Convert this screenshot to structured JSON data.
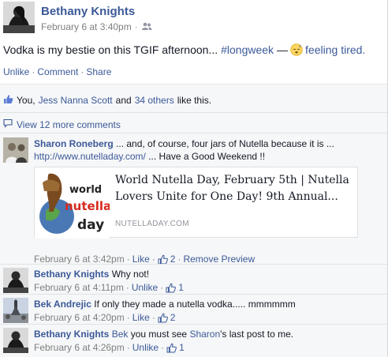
{
  "post": {
    "author": "Bethany Knights",
    "timestamp": "February 6 at 3:40pm",
    "audience_icon": "friends-icon",
    "status_text": "Vodka is my bestie on this TGIF afternoon...",
    "hashtag": "#longweek",
    "dash": "—",
    "feeling_icon": "sleepy-face-emoji",
    "feeling_text": "feeling tired.",
    "actions": {
      "unlike": "Unlike",
      "comment": "Comment",
      "share": "Share",
      "separator": "·"
    }
  },
  "likes": {
    "icon": "like-thumb-icon",
    "you": "You,",
    "friend": "Jess Nanna Scott",
    "and": "and",
    "others": "34 others",
    "suffix": "like this."
  },
  "more_comments": {
    "icon": "comment-bubble-icon",
    "label": "View 12 more comments"
  },
  "comments": [
    {
      "author": "Sharon Roneberg",
      "text": "... and, of course, four jars of Nutella because it is ...",
      "link": "http://www.nutelladay.com/",
      "link_suffix": "... Have a Good Weekend !!",
      "preview": {
        "title": "World Nutella Day, February 5th | Nutella Lovers Unite for One Day! 9th Annual...",
        "domain": "NUTELLADAY.COM",
        "image_words": [
          "world",
          "nutella",
          "day"
        ]
      },
      "time": "February 6 at 3:42pm",
      "action": "Like",
      "like_count": "2",
      "extra": "Remove Preview"
    },
    {
      "author": "Bethany Knights",
      "text": "Why not!",
      "time": "February 6 at 4:11pm",
      "action": "Unlike",
      "like_count": "1"
    },
    {
      "author": "Bek Andrejic",
      "text": "If only they made a nutella vodka..... mmmmmm",
      "time": "February 6 at 4:20pm",
      "action": "Like",
      "like_count": "2"
    },
    {
      "author": "Bethany Knights",
      "mention1": "Bek",
      "text_mid": "you must see",
      "mention2": "Sharon",
      "text_end": "'s last post to me.",
      "time": "February 6 at 4:26pm",
      "action": "Unlike",
      "like_count": "1"
    }
  ],
  "colors": {
    "link": "#3b5998",
    "meta": "#7f7f7f",
    "ufi_bg": "#f6f7f8",
    "text": "#141823"
  }
}
